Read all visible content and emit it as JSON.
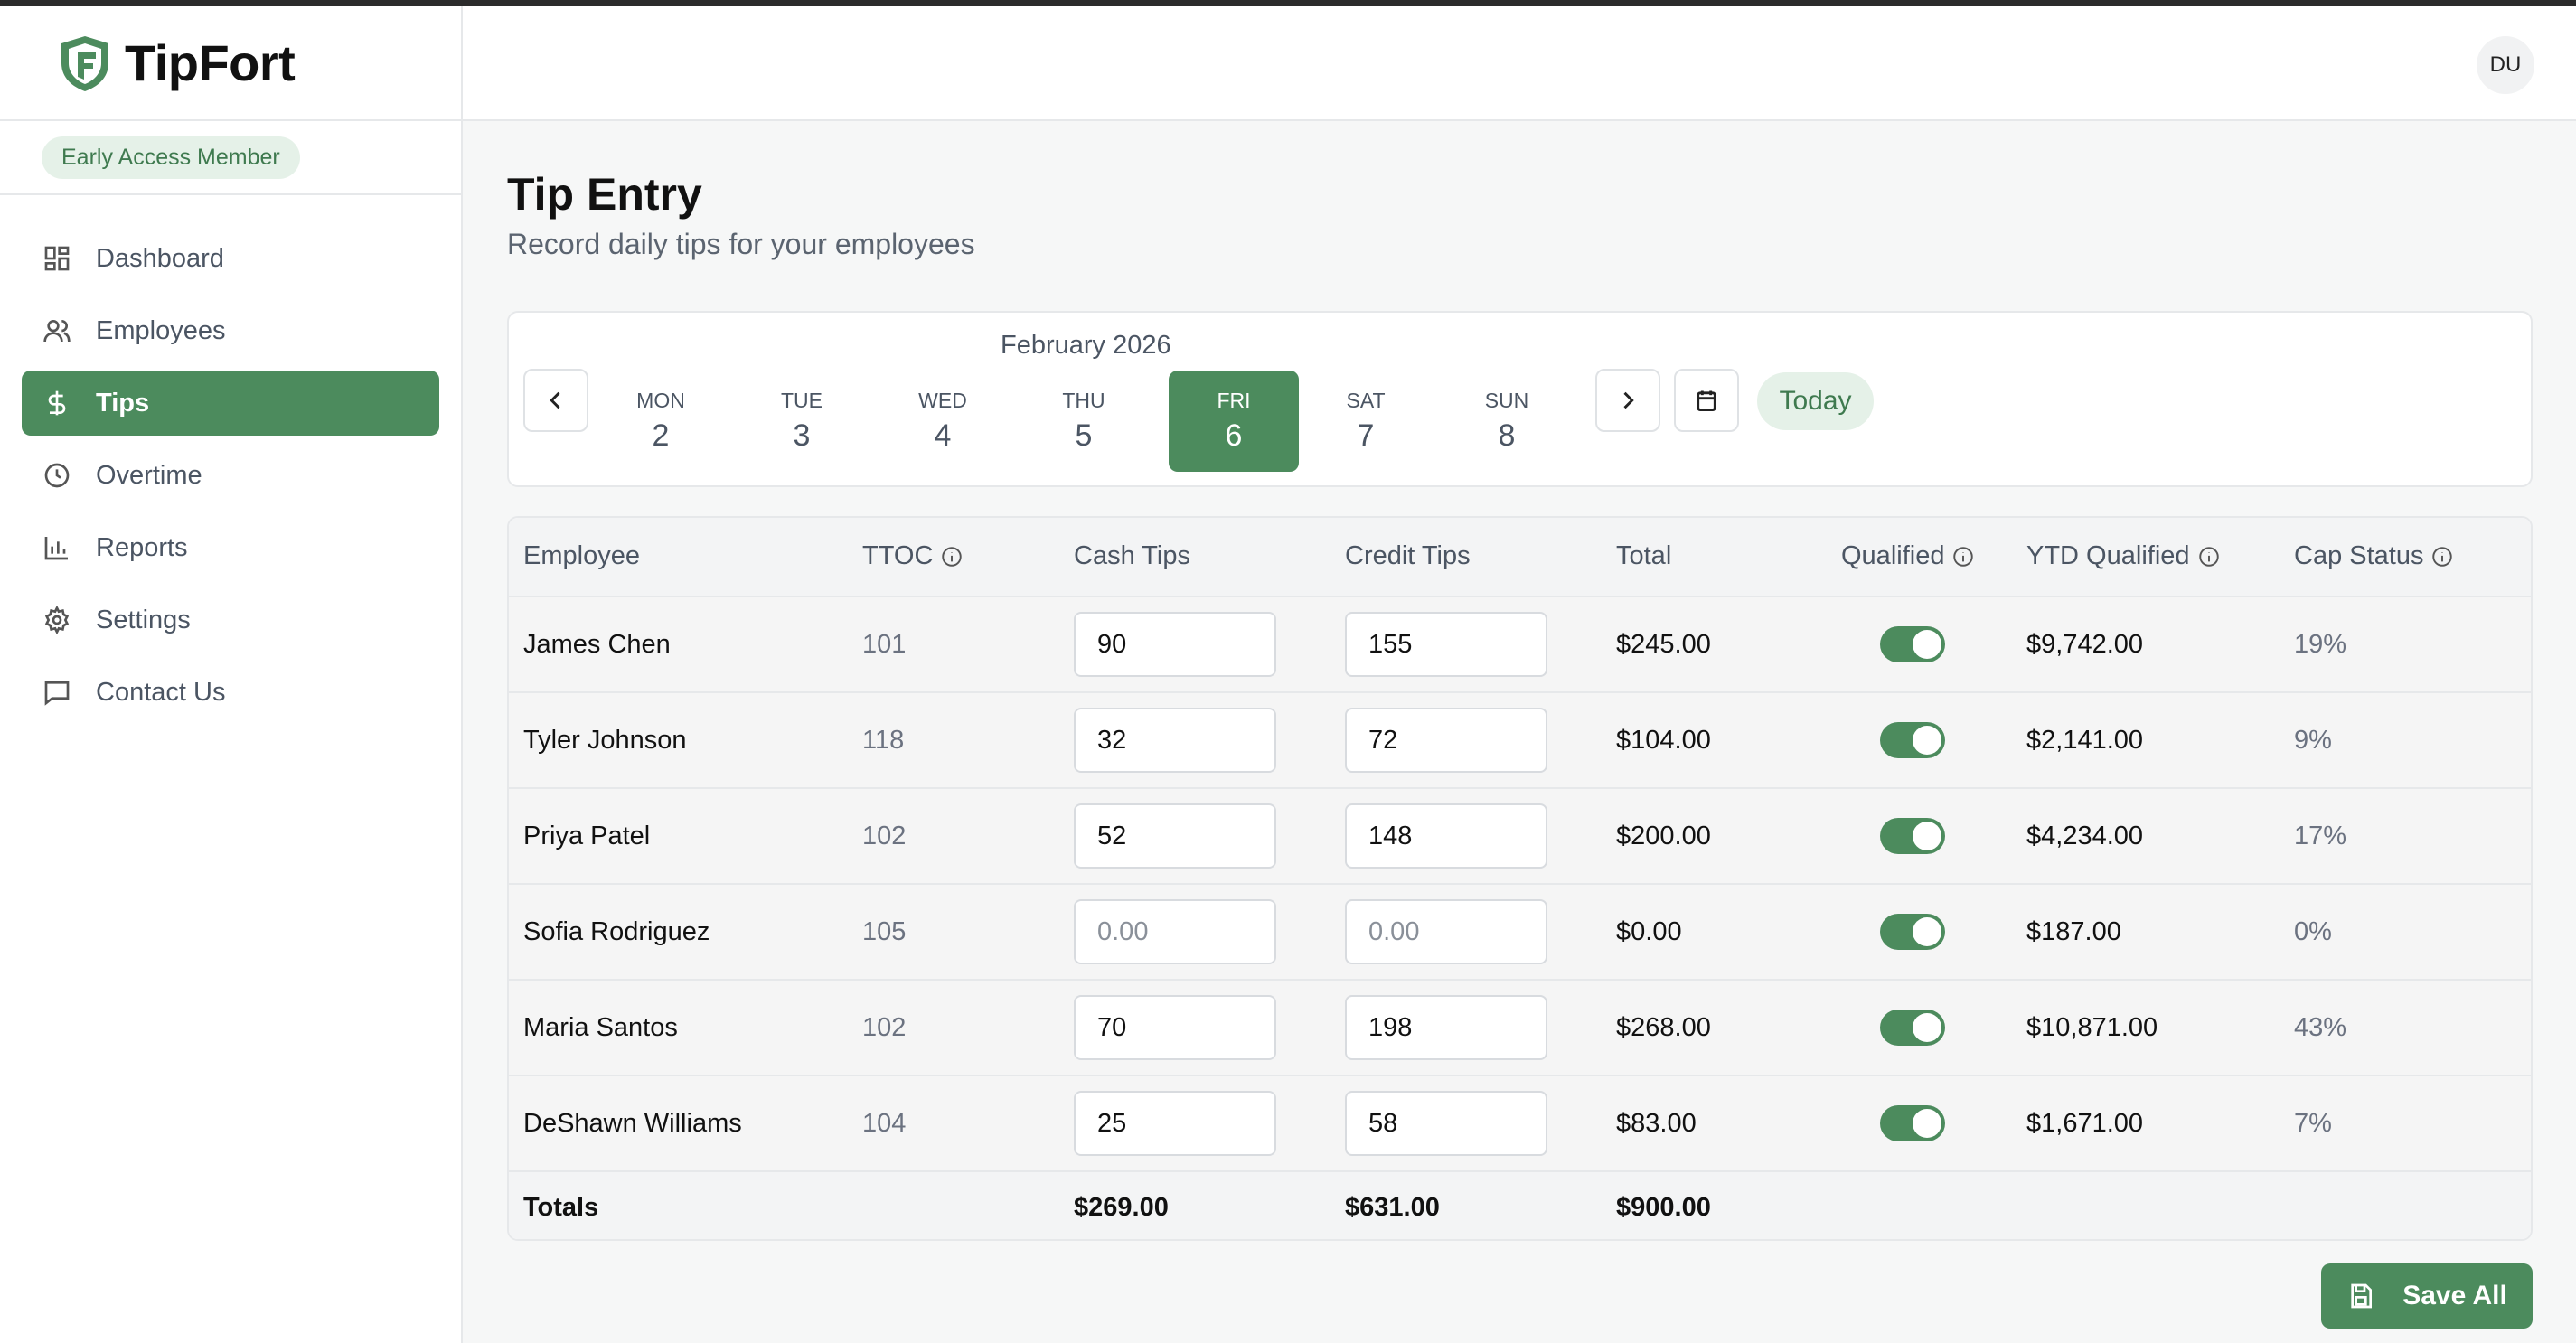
{
  "brand": {
    "name": "TipFort",
    "badge": "Early Access Member"
  },
  "user": {
    "initials": "DU"
  },
  "nav": [
    {
      "label": "Dashboard",
      "icon": "dashboard-icon"
    },
    {
      "label": "Employees",
      "icon": "users-icon"
    },
    {
      "label": "Tips",
      "icon": "dollar-icon",
      "active": true
    },
    {
      "label": "Overtime",
      "icon": "clock-icon"
    },
    {
      "label": "Reports",
      "icon": "bar-chart-icon"
    },
    {
      "label": "Settings",
      "icon": "gear-icon"
    },
    {
      "label": "Contact Us",
      "icon": "message-icon"
    }
  ],
  "page": {
    "title": "Tip Entry",
    "subtitle": "Record daily tips for your employees"
  },
  "week": {
    "month": "February 2026",
    "today_label": "Today",
    "days": [
      {
        "name": "MON",
        "num": "2"
      },
      {
        "name": "TUE",
        "num": "3"
      },
      {
        "name": "WED",
        "num": "4"
      },
      {
        "name": "THU",
        "num": "5"
      },
      {
        "name": "FRI",
        "num": "6",
        "selected": true
      },
      {
        "name": "SAT",
        "num": "7"
      },
      {
        "name": "SUN",
        "num": "8"
      }
    ]
  },
  "table": {
    "headers": {
      "employee": "Employee",
      "ttoc": "TTOC",
      "cash": "Cash Tips",
      "credit": "Credit Tips",
      "total": "Total",
      "qualified": "Qualified",
      "ytd": "YTD Qualified",
      "cap": "Cap Status"
    },
    "rows": [
      {
        "name": "James Chen",
        "ttoc": "101",
        "cash": "90",
        "credit": "155",
        "total": "$245.00",
        "qualified": true,
        "ytd": "$9,742.00",
        "cap": "19%"
      },
      {
        "name": "Tyler Johnson",
        "ttoc": "118",
        "cash": "32",
        "credit": "72",
        "total": "$104.00",
        "qualified": true,
        "ytd": "$2,141.00",
        "cap": "9%"
      },
      {
        "name": "Priya Patel",
        "ttoc": "102",
        "cash": "52",
        "credit": "148",
        "total": "$200.00",
        "qualified": true,
        "ytd": "$4,234.00",
        "cap": "17%"
      },
      {
        "name": "Sofia Rodriguez",
        "ttoc": "105",
        "cash": "",
        "credit": "",
        "cash_placeholder": "0.00",
        "credit_placeholder": "0.00",
        "total": "$0.00",
        "qualified": true,
        "ytd": "$187.00",
        "cap": "0%"
      },
      {
        "name": "Maria Santos",
        "ttoc": "102",
        "cash": "70",
        "credit": "198",
        "total": "$268.00",
        "qualified": true,
        "ytd": "$10,871.00",
        "cap": "43%"
      },
      {
        "name": "DeShawn Williams",
        "ttoc": "104",
        "cash": "25",
        "credit": "58",
        "total": "$83.00",
        "qualified": true,
        "ytd": "$1,671.00",
        "cap": "7%"
      }
    ],
    "totals": {
      "label": "Totals",
      "cash": "$269.00",
      "credit": "$631.00",
      "total": "$900.00"
    }
  },
  "actions": {
    "save_label": "Save All"
  },
  "colors": {
    "accent": "#4c8b5d",
    "badge_bg": "#e5f1e8",
    "badge_text": "#3f7a4f"
  }
}
